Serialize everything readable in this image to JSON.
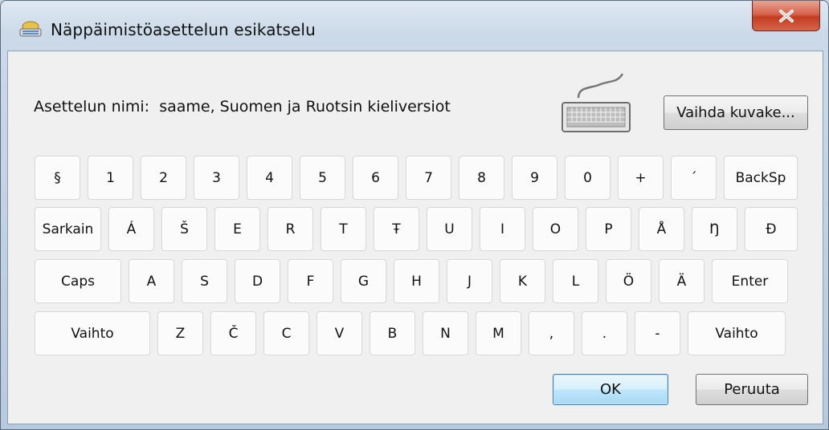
{
  "window": {
    "title": "Näppäimistöasettelun esikatselu",
    "close_glyph": "x"
  },
  "layout": {
    "label": "Asettelun nimi:",
    "name": "saame, Suomen ja Ruotsin kieliversiot"
  },
  "buttons": {
    "change_icon": "Vaihda kuvake...",
    "ok": "OK",
    "cancel": "Peruuta"
  },
  "keyboard": {
    "rows": [
      [
        "§",
        "1",
        "2",
        "3",
        "4",
        "5",
        "6",
        "7",
        "8",
        "9",
        "0",
        "+",
        "´",
        "BackSp"
      ],
      [
        "Sarkain",
        "Á",
        "Š",
        "E",
        "R",
        "T",
        "Ŧ",
        "U",
        "I",
        "O",
        "P",
        "Å",
        "Ŋ",
        "Đ"
      ],
      [
        "Caps",
        "A",
        "S",
        "D",
        "F",
        "G",
        "H",
        "J",
        "K",
        "L",
        "Ö",
        "Ä",
        "Enter"
      ],
      [
        "Vaihto",
        "Z",
        "Č",
        "C",
        "V",
        "B",
        "N",
        "M",
        ",",
        ".",
        "-",
        "Vaihto"
      ]
    ]
  },
  "icons": {
    "title": "keyboard-layout-icon",
    "preview": "keyboard-icon",
    "close": "close-icon"
  }
}
